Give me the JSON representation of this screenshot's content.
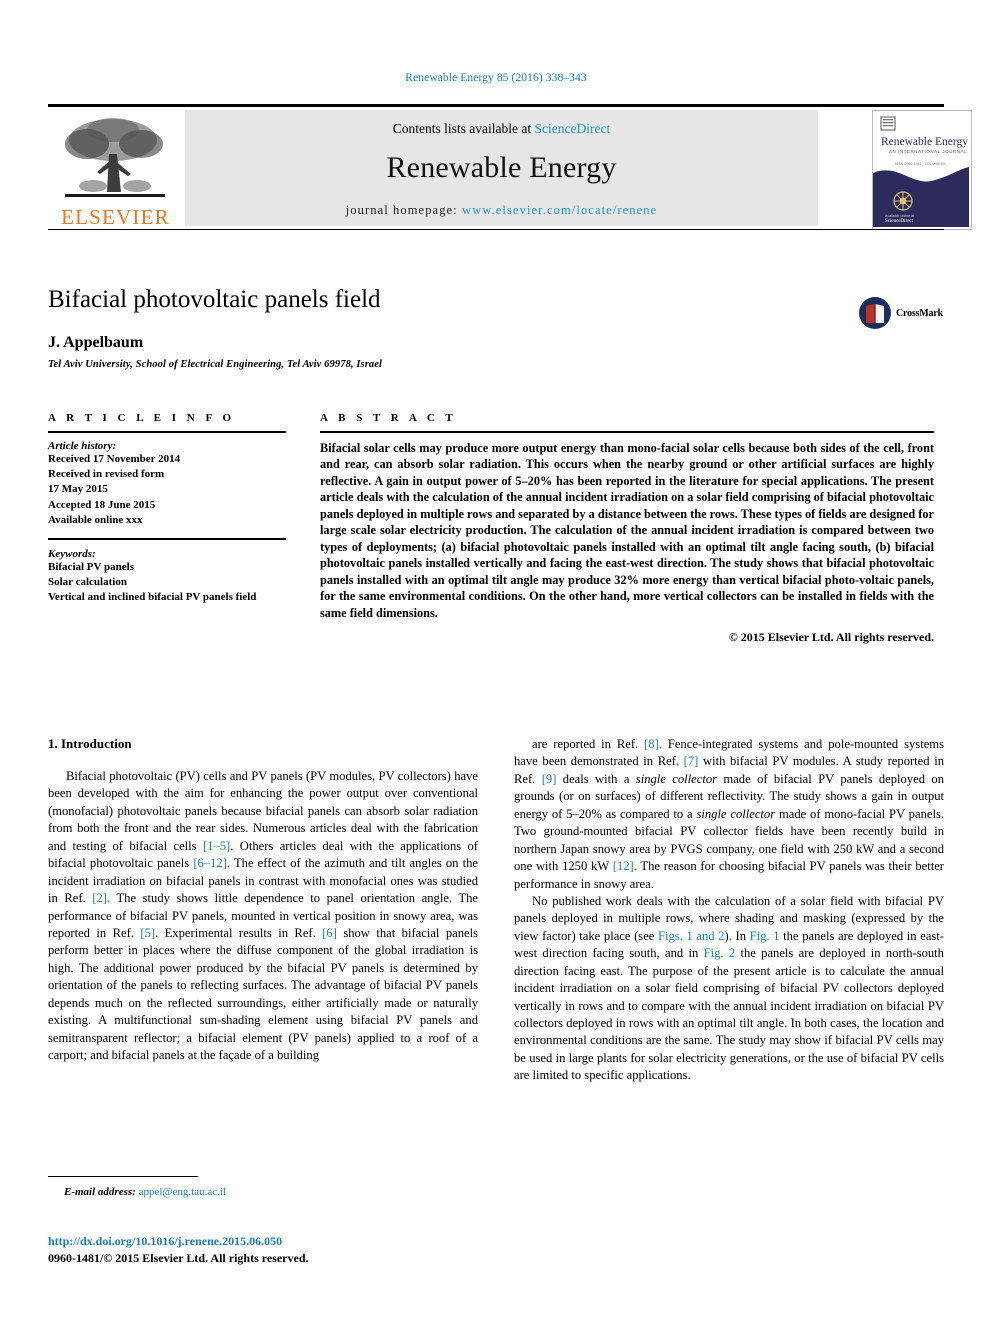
{
  "running_head": "Renewable Energy 85 (2016) 338–343",
  "masthead": {
    "contents_prefix": "Contents lists available at ",
    "sciencedirect": "ScienceDirect",
    "journal_name": "Renewable Energy",
    "homepage_prefix": "journal homepage: ",
    "homepage_url": "www.elsevier.com/locate/renene",
    "publisher_wordmark": "ELSEVIER",
    "cover": {
      "title": "Renewable Energy",
      "subtitle": "AN INTERNATIONAL JOURNAL"
    }
  },
  "article": {
    "title": "Bifacial photovoltaic panels field",
    "authors": "J. Appelbaum",
    "affiliation": "Tel Aviv University, School of Electrical Engineering, Tel Aviv 69978, Israel",
    "crossmark_label": "CrossMark"
  },
  "article_info": {
    "heading": "A R T I C L E   I N F O",
    "history_label": "Article history:",
    "history": [
      "Received 17 November 2014",
      "Received in revised form",
      "17 May 2015",
      "Accepted 18 June 2015",
      "Available online xxx"
    ],
    "keywords_label": "Keywords:",
    "keywords": [
      "Bifacial PV panels",
      "Solar calculation",
      "Vertical and inclined bifacial PV panels field"
    ]
  },
  "abstract": {
    "heading": "A B S T R A C T",
    "text": "Bifacial solar cells may produce more output energy than mono-facial solar cells because both sides of the cell, front and rear, can absorb solar radiation. This occurs when the nearby ground or other artificial surfaces are highly reflective. A gain in output power of 5–20% has been reported in the literature for special applications. The present article deals with the calculation of the annual incident irradiation on a solar field comprising of bifacial photovoltaic panels deployed in multiple rows and separated by a distance between the rows. These types of fields are designed for large scale solar electricity production. The calculation of the annual incident irradiation is compared between two types of deployments; (a) bifacial photovoltaic panels installed with an optimal tilt angle facing south, (b) bifacial photovoltaic panels installed vertically and facing the east-west direction. The study shows that bifacial photovoltaic panels installed with an optimal tilt angle may produce 32% more energy than vertical bifacial photo-voltaic panels, for the same environmental conditions. On the other hand, more vertical collectors can be installed in fields with the same field dimensions.",
    "copyright": "© 2015 Elsevier Ltd. All rights reserved."
  },
  "body": {
    "section_number_title": "1. Introduction",
    "left_paragraph_1": "Bifacial photovoltaic (PV) cells and PV panels (PV modules, PV collectors) have been developed with the aim for enhancing the power output over conventional (monofacial) photovoltaic panels because bifacial panels can absorb solar radiation from both the front and the rear sides. Numerous articles deal with the fabrication and testing of bifacial cells [1–5]. Others articles deal with the applications of bifacial photovoltaic panels [6–12]. The effect of the azimuth and tilt angles on the incident irradiation on bifacial panels in contrast with monofacial ones was studied in Ref. [2]. The study shows little dependence to panel orientation angle. The performance of bifacial PV panels, mounted in vertical position in snowy area, was reported in Ref. [5]. Experimental results in Ref. [6] show that bifacial panels perform better in places where the diffuse component of the global irradiation is high. The additional power produced by the bifacial PV panels is determined by orientation of the panels to reflecting surfaces. The advantage of bifacial PV panels depends much on the reflected surroundings, either artificially made or naturally existing. A multifunctional sun-shading element using bifacial PV panels and semitransparent reflector; a bifacial element (PV panels) applied to a roof of a carport; and bifacial panels at the façade of a building",
    "right_paragraph_1": "are reported in Ref. [8]. Fence-integrated systems and pole-mounted systems have been demonstrated in Ref. [7] with bifacial PV modules. A study reported in Ref. [9] deals with a single collector made of bifacial PV panels deployed on grounds (or on surfaces) of different reflectivity. The study shows a gain in output energy of 5–20% as compared to a single collector made of mono-facial PV panels. Two ground-mounted bifacial PV collector fields have been recently build in northern Japan snowy area by PVGS company, one field with 250 kW and a second one with 1250 kW [12]. The reason for choosing bifacial PV panels was their better performance in snowy area.",
    "right_paragraph_2": "No published work deals with the calculation of a solar field with bifacial PV panels deployed in multiple rows, where shading and masking (expressed by the view factor) take place (see Figs. 1 and 2). In Fig. 1 the panels are deployed in east-west direction facing south, and in Fig. 2 the panels are deployed in north-south direction facing east. The purpose of the present article is to calculate the annual incident irradiation on a solar field comprising of bifacial PV collectors deployed vertically in rows and to compare with the annual incident irradiation on bifacial PV collectors deployed in rows with an optimal tilt angle. In both cases, the location and environmental conditions are the same. The study may show if bifacial PV cells may be used in large plants for solar electricity generations, or the use of bifacial PV cells are limited to specific applications."
  },
  "footer": {
    "email_label": "E-mail address:",
    "email": "appel@eng.tau.ac.il",
    "doi": "http://dx.doi.org/10.1016/j.renene.2015.06.050",
    "issn_line": "0960-1481/© 2015 Elsevier Ltd. All rights reserved."
  },
  "colors": {
    "link": "#1a7bb9",
    "sciencedirect": "#2196c4",
    "elsevier_orange": "#E87722",
    "band_gray": "#e6e6e6",
    "cover_navy": "#2d2a5e"
  }
}
